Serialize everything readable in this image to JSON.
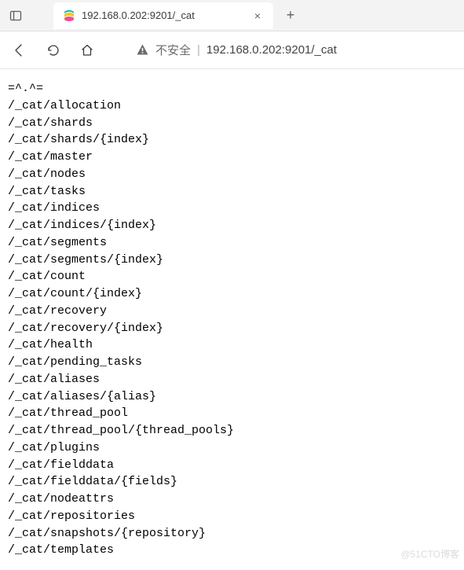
{
  "tab": {
    "title": "192.168.0.202:9201/_cat",
    "close_glyph": "×",
    "new_tab_glyph": "+"
  },
  "address": {
    "security_label": "不安全",
    "separator": "|",
    "url": "192.168.0.202:9201/_cat"
  },
  "body_lines": [
    "=^.^=",
    "/_cat/allocation",
    "/_cat/shards",
    "/_cat/shards/{index}",
    "/_cat/master",
    "/_cat/nodes",
    "/_cat/tasks",
    "/_cat/indices",
    "/_cat/indices/{index}",
    "/_cat/segments",
    "/_cat/segments/{index}",
    "/_cat/count",
    "/_cat/count/{index}",
    "/_cat/recovery",
    "/_cat/recovery/{index}",
    "/_cat/health",
    "/_cat/pending_tasks",
    "/_cat/aliases",
    "/_cat/aliases/{alias}",
    "/_cat/thread_pool",
    "/_cat/thread_pool/{thread_pools}",
    "/_cat/plugins",
    "/_cat/fielddata",
    "/_cat/fielddata/{fields}",
    "/_cat/nodeattrs",
    "/_cat/repositories",
    "/_cat/snapshots/{repository}",
    "/_cat/templates"
  ],
  "watermark": "@51CTO博客"
}
